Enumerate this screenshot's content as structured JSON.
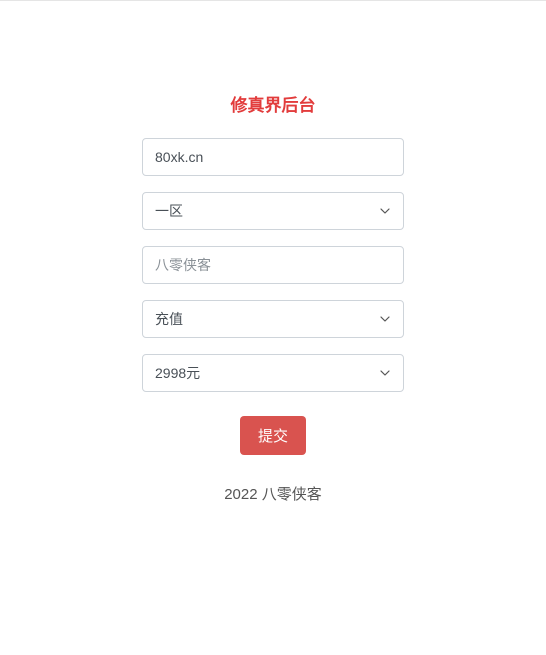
{
  "title": "修真界后台",
  "form": {
    "site_value": "80xk.cn",
    "area_selected": "一区",
    "username_placeholder": "八零侠客",
    "action_selected": "充值",
    "amount_selected": "2998元",
    "submit_label": "提交"
  },
  "footer_text": "2022 八零侠客"
}
